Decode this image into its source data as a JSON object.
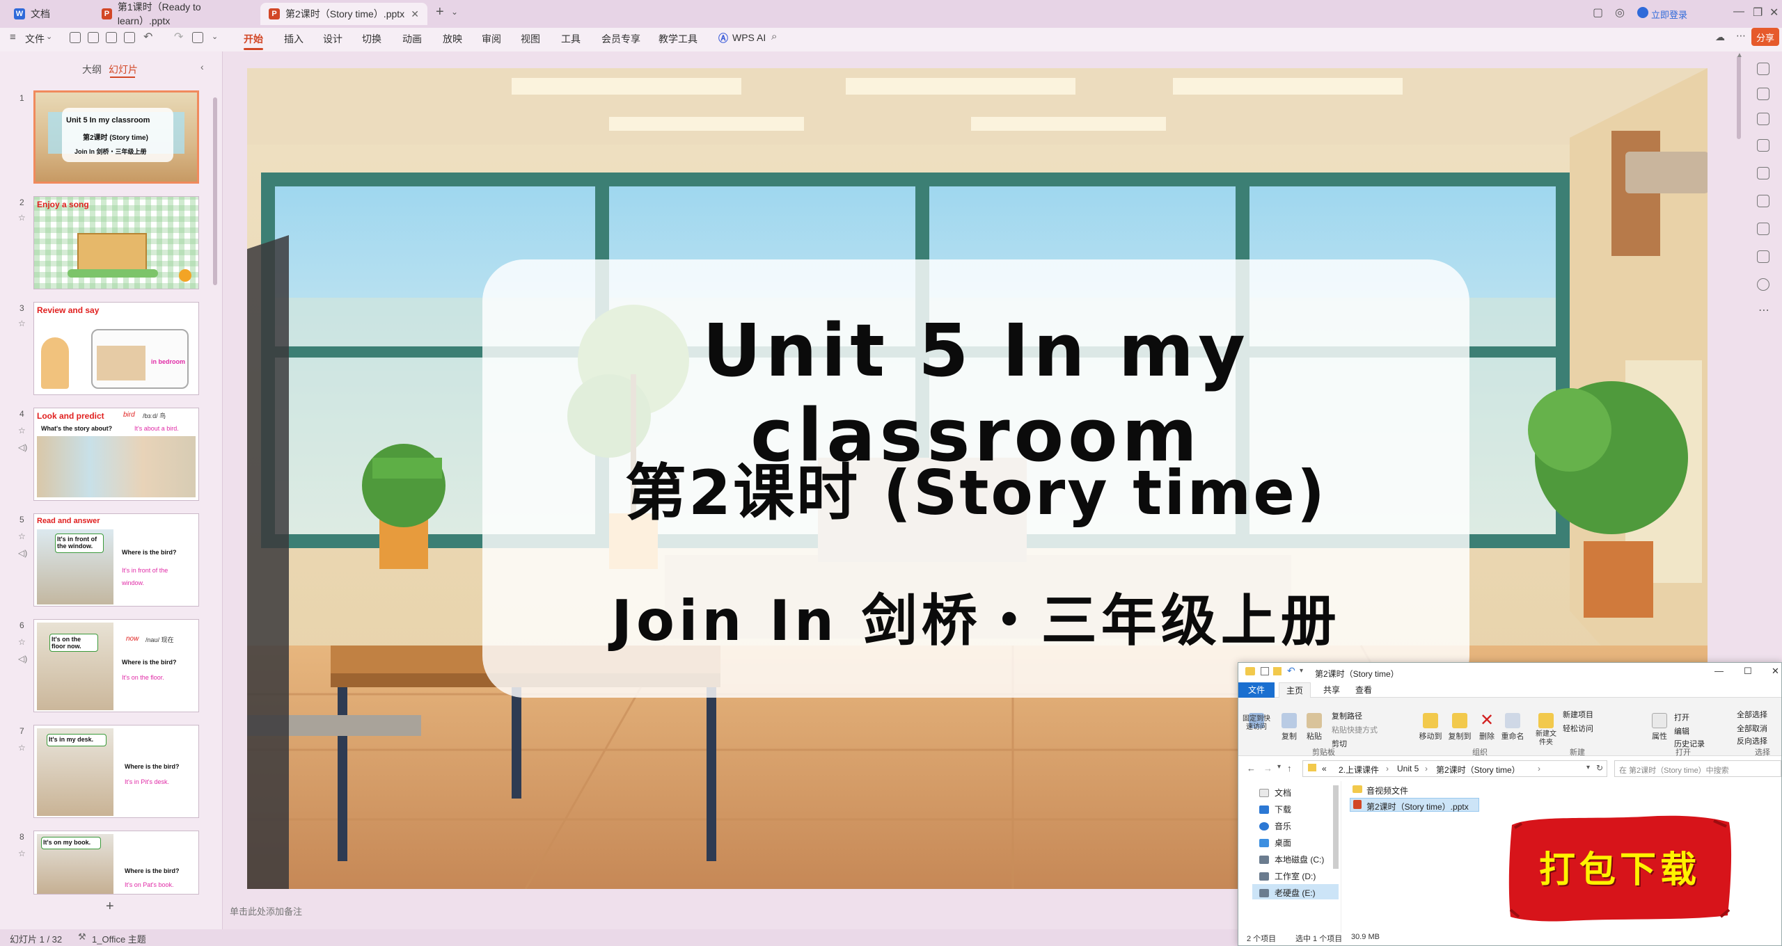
{
  "tabs": [
    {
      "label": "文档",
      "color": "#2f6ad9",
      "glyph": "W"
    },
    {
      "label": "第1课时（Ready to learn）.pptx",
      "color": "#d24726",
      "glyph": "P"
    },
    {
      "label": "第2课时（Story time）.pptx",
      "color": "#d24726",
      "glyph": "P",
      "active": true
    }
  ],
  "titlebar": {
    "login": "立即登录",
    "share": "分享"
  },
  "menu": {
    "file": "文件",
    "items": [
      "开始",
      "插入",
      "设计",
      "切换",
      "动画",
      "放映",
      "审阅",
      "视图",
      "工具",
      "会员专享",
      "教学工具"
    ],
    "wps_ai": "WPS AI"
  },
  "panel": {
    "tab_outline": "大纲",
    "tab_slides": "幻灯片",
    "add": "+"
  },
  "thumbnails": [
    {
      "num": "1",
      "title": "Unit 5 In my classroom",
      "sub": "第2课时 (Story time)",
      "sub2": "Join In 剑桥・三年级上册"
    },
    {
      "num": "2",
      "title": "Enjoy a song"
    },
    {
      "num": "3",
      "title": "Review and say",
      "note": "in bedroom"
    },
    {
      "num": "4",
      "title": "Look and predict",
      "q": "What's the story about?",
      "a": "It's about a bird.",
      "word": "bird",
      "phon": "/bɜːd/ 鸟"
    },
    {
      "num": "5",
      "title": "Read and answer",
      "bubble": "It's in front of the window.",
      "q": "Where is the bird?",
      "a": "It's in front of the window."
    },
    {
      "num": "6",
      "title": "",
      "bubble": "It's on the floor now.",
      "word": "now",
      "phon": "/naʊ/ 现在",
      "q": "Where is the bird?",
      "a": "It's on the floor."
    },
    {
      "num": "7",
      "title": "",
      "bubble": "It's in my desk.",
      "q": "Where is the bird?",
      "a": "It's in Pit's desk."
    },
    {
      "num": "8",
      "title": "",
      "bubble": "It's on my book.",
      "q": "Where is the bird?",
      "a": "It's on Pat's book."
    }
  ],
  "slide": {
    "title": "Unit 5 In my classroom",
    "subtitle": "第2课时 (Story time)",
    "course": "Join In 剑桥・三年级上册"
  },
  "notes_placeholder": "单击此处添加备注",
  "status": {
    "slide_counter": "幻灯片 1 / 32",
    "theme": "1_Office 主题"
  },
  "explorer": {
    "title": "第2课时（Story time）",
    "ribbon_tabs": [
      "文件",
      "主页",
      "共享",
      "查看"
    ],
    "groups": {
      "clipboard": {
        "label": "剪贴板",
        "pin": "固定到快速访问",
        "copy": "复制",
        "paste": "粘贴",
        "copy_path": "复制路径",
        "paste_shortcut": "粘贴快捷方式",
        "cut": "剪切"
      },
      "organize": {
        "label": "组织",
        "move": "移动到",
        "copyto": "复制到",
        "delete": "删除",
        "rename": "重命名"
      },
      "new": {
        "label": "新建",
        "folder": "新建文件夹",
        "item": "新建项目",
        "easy": "轻松访问"
      },
      "open": {
        "label": "打开",
        "props": "属性",
        "open": "打开",
        "edit": "编辑",
        "history": "历史记录"
      },
      "select": {
        "label": "选择",
        "all": "全部选择",
        "none": "全部取消",
        "invert": "反向选择"
      }
    },
    "breadcrumb": [
      "«",
      "2.上课课件",
      "Unit 5",
      "第2课时（Story time）"
    ],
    "search_placeholder": "在 第2课时（Story time）中搜索",
    "nav": [
      "文档",
      "下载",
      "音乐",
      "桌面",
      "本地磁盘 (C:)",
      "工作室 (D:)",
      "老硬盘 (E:)"
    ],
    "files": [
      {
        "name": "音视频文件",
        "type": "folder"
      },
      {
        "name": "第2课时（Story time）.pptx",
        "type": "pptx",
        "selected": true
      }
    ],
    "status": {
      "items": "2 个项目",
      "selected": "选中 1 个项目",
      "size": "30.9 MB"
    }
  },
  "download_badge": "打包下载",
  "colors": {
    "accent": "#d24726",
    "badge_red": "#d7141a",
    "badge_text": "#fff200"
  }
}
